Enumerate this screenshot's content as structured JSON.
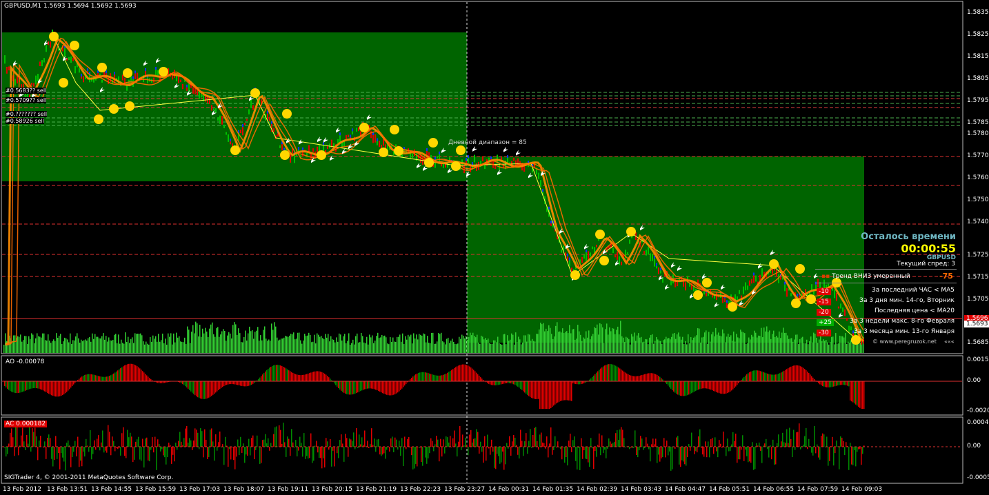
{
  "header": {
    "symbol_line": "GBPUSD,M1  1.5693 1.5694 1.5692 1.5693"
  },
  "price_axis": [
    "1.5835",
    "1.5825",
    "1.5815",
    "1.5805",
    "1.5795",
    "1.5785",
    "1.5780",
    "1.5770",
    "1.5760",
    "1.5750",
    "1.5740",
    "1.5725",
    "1.5715",
    "1.5705",
    "1.5693",
    "1.5685"
  ],
  "current_price": "1.5693",
  "current_price_red": "1.5696",
  "ao_axis": [
    "0.00154",
    "0.00",
    "-0.00204"
  ],
  "ac_axis": [
    "0.00041",
    "0.00",
    "-0.00053"
  ],
  "time_axis": [
    "13 Feb 2012",
    "13 Feb 13:51",
    "13 Feb 14:55",
    "13 Feb 15:59",
    "13 Feb 17:03",
    "13 Feb 18:07",
    "13 Feb 19:11",
    "13 Feb 20:15",
    "13 Feb 21:19",
    "13 Feb 22:23",
    "13 Feb 23:27",
    "14 Feb 00:31",
    "14 Feb 01:35",
    "14 Feb 02:39",
    "14 Feb 03:43",
    "14 Feb 04:47",
    "14 Feb 05:51",
    "14 Feb 06:55",
    "14 Feb 07:59",
    "14 Feb 09:03"
  ],
  "daily_range": "Дневной диапазон = 85",
  "ao_label": "AO -0.00078",
  "ac_label": "AC 0.000182",
  "copyright": "SIGTrader 4, © 2001-2011 MetaQuotes Software Corp.",
  "left_orders": [
    "#0.5683?? sell",
    "#0.5709?? sell",
    "#0.??????? sell",
    "#0.58926 sell"
  ],
  "info": {
    "remaining_title": "Осталось времени",
    "timer": "00:00:55",
    "symbol": "GBPUSD",
    "spread": "Текущий спред: 3",
    "trend": "Тренд ВНИЗ умеренный",
    "trend_value": "-75",
    "rows": [
      {
        "badge": "-10",
        "text": "За последний ЧАС < MA5",
        "color": "#e00000"
      },
      {
        "badge": "-15",
        "text": "За 3 дня мин. 14-го, Вторник",
        "color": "#e00000"
      },
      {
        "badge": "-20",
        "text": "Последняя цена < MA20",
        "color": "#e00000"
      },
      {
        "badge": "+25",
        "text": "За 3 недели макс. 8-го Февраля",
        "color": "#00b000"
      },
      {
        "badge": "-30",
        "text": "За 3 месяца мин. 13-го Января",
        "color": "#e00000"
      }
    ],
    "website": "© www.peregruzok.net",
    "website_suffix": "«««"
  },
  "colors": {
    "background": "#000000",
    "zone_green": "#006400",
    "volume_green": "#32cd32",
    "ma_orange": "#ff6a00",
    "down_red": "#e00000",
    "up_green": "#00c000",
    "coin_yellow": "#ffd700",
    "timer_yellow": "#ffff00",
    "title_teal": "#6fb7c3"
  }
}
